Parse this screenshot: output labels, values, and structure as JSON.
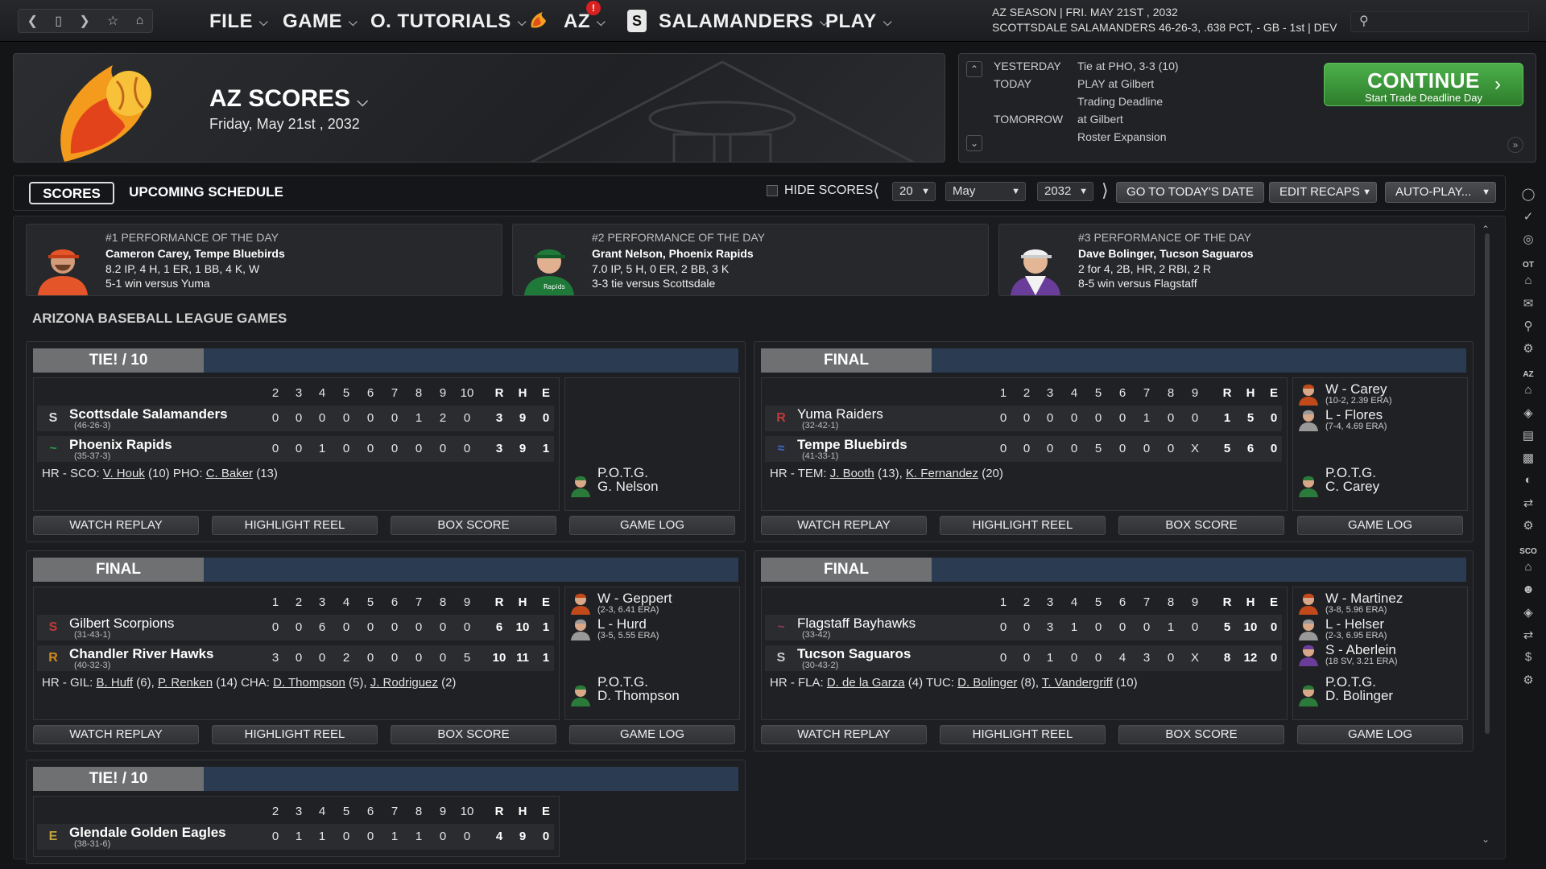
{
  "topbar": {
    "file": "FILE",
    "game": "GAME",
    "tutorials": "O. TUTORIALS",
    "az": "AZ",
    "az_badge": "!",
    "team": "SALAMANDERS",
    "play": "PLAY",
    "season_line1": "AZ SEASON  |  FRI. MAY 21ST , 2032",
    "season_line2": "SCOTTSDALE SALAMANDERS  46-26-3, .638 PCT, - GB - 1st | DEV"
  },
  "header": {
    "title": "AZ SCORES",
    "date": "Friday, May 21st , 2032"
  },
  "events": {
    "yesterday_label": "YESTERDAY",
    "yesterday": "Tie at PHO, 3-3 (10)",
    "today_label": "TODAY",
    "today1": "PLAY at Gilbert",
    "today2": "Trading Deadline",
    "tomorrow_label": "TOMORROW",
    "tomorrow1": "at Gilbert",
    "tomorrow2": "Roster Expansion"
  },
  "continue": {
    "label": "CONTINUE",
    "sub": "Start Trade Deadline Day"
  },
  "tabs": {
    "scores": "SCORES",
    "upcoming": "UPCOMING SCHEDULE",
    "hide": "HIDE SCORES",
    "day": "20",
    "month": "May",
    "year": "2032",
    "goto": "GO TO TODAY'S DATE",
    "edit": "EDIT RECAPS",
    "auto": "AUTO-PLAY..."
  },
  "perf": [
    {
      "title": "#1 PERFORMANCE OF THE DAY",
      "name": "Cameron Carey, Tempe Bluebirds",
      "line1": "8.2 IP, 4 H, 1 ER, 1 BB, 4 K, W",
      "line2": "5-1 win versus Yuma"
    },
    {
      "title": "#2 PERFORMANCE OF THE DAY",
      "name": "Grant Nelson, Phoenix Rapids",
      "line1": "7.0 IP, 5 H, 0 ER, 2 BB, 3 K",
      "line2": "3-3 tie versus Scottsdale"
    },
    {
      "title": "#3 PERFORMANCE OF THE DAY",
      "name": "Dave Bolinger, Tucson Saguaros",
      "line1": "2 for 4, 2B, HR, 2 RBI, 2 R",
      "line2": "8-5 win versus Flagstaff"
    }
  ],
  "section": "ARIZONA BASEBALL LEAGUE GAMES",
  "buttons": {
    "replay": "WATCH REPLAY",
    "reel": "HIGHLIGHT REEL",
    "box": "BOX SCORE",
    "log": "GAME LOG"
  },
  "games": {
    "g1": {
      "status": "TIE! / 10",
      "innings": [
        "2",
        "3",
        "4",
        "5",
        "6",
        "7",
        "8",
        "9",
        "10"
      ],
      "rhe": [
        "R",
        "H",
        "E"
      ],
      "away": {
        "name": "Scottsdale Salamanders",
        "rec": "(46-26-3)",
        "line": [
          "0",
          "0",
          "0",
          "0",
          "0",
          "0",
          "1",
          "2",
          "0"
        ],
        "r": "3",
        "h": "9",
        "e": "0"
      },
      "home": {
        "name": "Phoenix Rapids",
        "rec": "(35-37-3)",
        "line": [
          "0",
          "0",
          "1",
          "0",
          "0",
          "0",
          "0",
          "0",
          "0"
        ],
        "r": "3",
        "h": "9",
        "e": "1"
      },
      "hr_pre": "HR - SCO: ",
      "hr_a1": "V. Houk",
      "hr_a1n": " (10)  PHO: ",
      "hr_a2": "C. Baker",
      "hr_a2n": " (13)",
      "potg": "P.O.T.G.",
      "potg_name": "G. Nelson"
    },
    "g2": {
      "status": "FINAL",
      "innings": [
        "1",
        "2",
        "3",
        "4",
        "5",
        "6",
        "7",
        "8",
        "9"
      ],
      "rhe": [
        "R",
        "H",
        "E"
      ],
      "away": {
        "name": "Yuma Raiders",
        "rec": "(32-42-1)",
        "line": [
          "0",
          "0",
          "0",
          "0",
          "0",
          "0",
          "1",
          "0",
          "0"
        ],
        "r": "1",
        "h": "5",
        "e": "0"
      },
      "home": {
        "name": "Tempe Bluebirds",
        "rec": "(41-33-1)",
        "line": [
          "0",
          "0",
          "0",
          "0",
          "5",
          "0",
          "0",
          "0",
          "X"
        ],
        "r": "5",
        "h": "6",
        "e": "0"
      },
      "hr_pre": "HR - TEM: ",
      "hr_a1": "J. Booth",
      "hr_a1n": " (13), ",
      "hr_a2": "K. Fernandez",
      "hr_a2n": " (20)",
      "w": "W - Carey",
      "w_sub": "(10-2, 2.39 ERA)",
      "l": "L - Flores",
      "l_sub": "(7-4, 4.69 ERA)",
      "potg": "P.O.T.G.",
      "potg_name": "C. Carey"
    },
    "g3": {
      "status": "FINAL",
      "innings": [
        "1",
        "2",
        "3",
        "4",
        "5",
        "6",
        "7",
        "8",
        "9"
      ],
      "rhe": [
        "R",
        "H",
        "E"
      ],
      "away": {
        "name": "Gilbert Scorpions",
        "rec": "(31-43-1)",
        "line": [
          "0",
          "0",
          "6",
          "0",
          "0",
          "0",
          "0",
          "0",
          "0"
        ],
        "r": "6",
        "h": "10",
        "e": "1"
      },
      "home": {
        "name": "Chandler River Hawks",
        "rec": "(40-32-3)",
        "line": [
          "3",
          "0",
          "0",
          "2",
          "0",
          "0",
          "0",
          "0",
          "5"
        ],
        "r": "10",
        "h": "11",
        "e": "1"
      },
      "hr_pre": "HR - GIL: ",
      "hr_a1": "B. Huff",
      "hr_a1n": " (6), ",
      "hr_a2": "P. Renken",
      "hr_a2n": " (14)  CHA: ",
      "hr_a3": "D. Thompson",
      "hr_a3n": " (5), ",
      "hr_a4": "J. Rodriguez",
      "hr_a4n": " (2)",
      "w": "W - Geppert",
      "w_sub": "(2-3, 6.41 ERA)",
      "l": "L - Hurd",
      "l_sub": "(3-5, 5.55 ERA)",
      "potg": "P.O.T.G.",
      "potg_name": "D. Thompson"
    },
    "g4": {
      "status": "FINAL",
      "innings": [
        "1",
        "2",
        "3",
        "4",
        "5",
        "6",
        "7",
        "8",
        "9"
      ],
      "rhe": [
        "R",
        "H",
        "E"
      ],
      "away": {
        "name": "Flagstaff Bayhawks",
        "rec": "(33-42)",
        "line": [
          "0",
          "0",
          "3",
          "1",
          "0",
          "0",
          "0",
          "1",
          "0"
        ],
        "r": "5",
        "h": "10",
        "e": "0"
      },
      "home": {
        "name": "Tucson Saguaros",
        "rec": "(30-43-2)",
        "line": [
          "0",
          "0",
          "1",
          "0",
          "0",
          "4",
          "3",
          "0",
          "X"
        ],
        "r": "8",
        "h": "12",
        "e": "0"
      },
      "hr_pre": "HR - FLA: ",
      "hr_a1": "D. de la Garza",
      "hr_a1n": " (4)  TUC: ",
      "hr_a2": "D. Bolinger",
      "hr_a2n": " (8), ",
      "hr_a3": "T. Vandergriff",
      "hr_a3n": " (10)",
      "w": "W - Martinez",
      "w_sub": "(3-8, 5.96 ERA)",
      "l": "L - Helser",
      "l_sub": "(2-3, 6.95 ERA)",
      "s": "S - Aberlein",
      "s_sub": "(18 SV, 3.21 ERA)",
      "potg": "P.O.T.G.",
      "potg_name": "D. Bolinger"
    },
    "g5": {
      "status": "TIE! / 10",
      "innings": [
        "2",
        "3",
        "4",
        "5",
        "6",
        "7",
        "8",
        "9",
        "10"
      ],
      "rhe": [
        "R",
        "H",
        "E"
      ],
      "away": {
        "name": "Glendale Golden Eagles",
        "rec": "(38-31-6)",
        "line": [
          "0",
          "1",
          "1",
          "0",
          "0",
          "1",
          "1",
          "0",
          "0"
        ],
        "r": "4",
        "h": "9",
        "e": "0"
      }
    }
  },
  "rail": {
    "ot": "OT",
    "az": "AZ",
    "sco": "SCO"
  }
}
